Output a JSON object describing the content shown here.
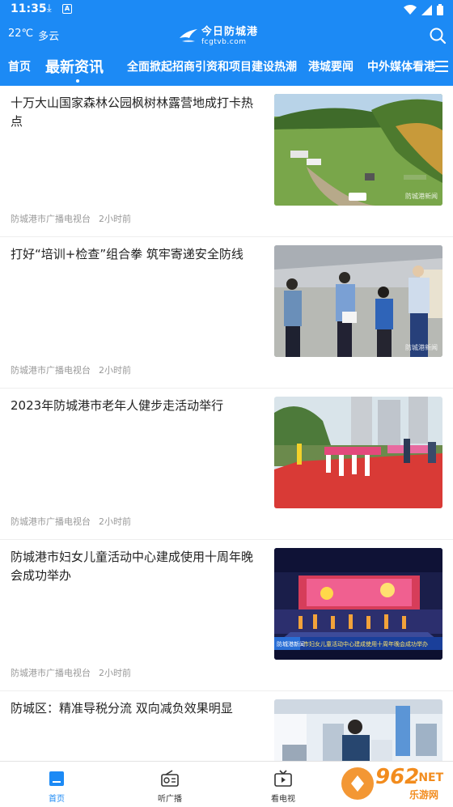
{
  "status_bar": {
    "time": "11:35",
    "a_label": "A"
  },
  "topbar": {
    "weather_temp": "22℃",
    "weather_desc": "多云",
    "logo_title": "今日防城港",
    "logo_sub": "fcgtvb.com"
  },
  "tabs": [
    {
      "label": "首页"
    },
    {
      "label": "最新资讯",
      "active": true
    },
    {
      "label": "全面掀起招商引资和项目建设热潮"
    },
    {
      "label": "港城要闻"
    },
    {
      "label": "中外媒体看港"
    }
  ],
  "news": [
    {
      "title": "十万大山国家森林公园枫树林露营地成打卡热点",
      "source": "防城港市广播电视台",
      "time": "2小时前",
      "thumb_tag": "防城港新闻"
    },
    {
      "title": "打好“培训+检查”组合拳 筑牢寄递安全防线",
      "source": "防城港市广播电视台",
      "time": "2小时前",
      "thumb_tag": "防城港新闻"
    },
    {
      "title": "2023年防城港市老年人健步走活动举行",
      "source": "防城港市广播电视台",
      "time": "2小时前",
      "thumb_tag": ""
    },
    {
      "title": "防城港市妇女儿童活动中心建成使用十周年晚会成功举办",
      "source": "防城港市广播电视台",
      "time": "2小时前",
      "thumb_tag": "防城港新闻",
      "thumb_caption": "市妇女儿童活动中心建成使用十周年晚会成功举办"
    },
    {
      "title": "防城区：精准导税分流 双向减负效果明显",
      "source": "",
      "time": "",
      "thumb_tag": ""
    }
  ],
  "bottom_nav": [
    {
      "label": "首页",
      "icon": "home-icon",
      "active": true
    },
    {
      "label": "听广播",
      "icon": "radio-icon"
    },
    {
      "label": "看电视",
      "icon": "tv-icon"
    },
    {
      "label": "",
      "icon": "more-icon"
    }
  ],
  "watermark": {
    "text": "962",
    "suffix": ".NET",
    "sub": "乐游网"
  },
  "colors": {
    "brand": "#1c8af5",
    "meta": "#999999"
  }
}
